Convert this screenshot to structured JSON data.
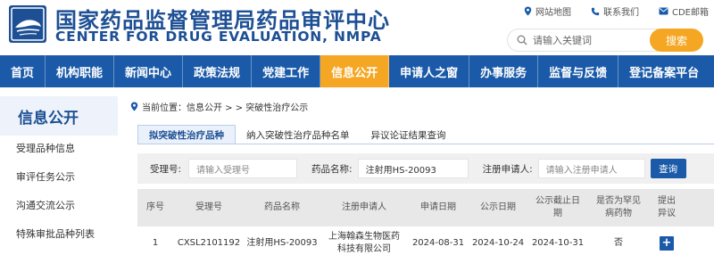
{
  "header": {
    "cn_title": "国家药品监督管理局药品审评中心",
    "en_title": "CENTER FOR DRUG EVALUATION, NMPA",
    "top_links": [
      {
        "label": "网站地图",
        "icon": "location-pin-icon"
      },
      {
        "label": "联系我们",
        "icon": "phone-icon"
      },
      {
        "label": "CDE邮箱",
        "icon": "mail-icon"
      }
    ],
    "search": {
      "placeholder": "请输入关键词",
      "button_label": "搜索"
    },
    "colors": {
      "brand_blue": "#1d4f94",
      "accent_orange": "#f5a623"
    }
  },
  "nav": {
    "items": [
      "首页",
      "机构职能",
      "新闻中心",
      "政策法规",
      "党建工作",
      "信息公开",
      "申请人之窗",
      "办事服务",
      "监督与反馈",
      "登记备案平台"
    ],
    "active_index": 5
  },
  "sidebar": {
    "title": "信息公开",
    "items": [
      "受理品种信息",
      "审评任务公示",
      "沟通交流公示",
      "特殊审批品种列表"
    ]
  },
  "breadcrumb": {
    "text": "当前位置：信息公开 > > 突破性治疗公示"
  },
  "tabs": {
    "items": [
      "拟突破性治疗品种",
      "纳入突破性治疗品种名单",
      "异议论证结果查询"
    ],
    "active_index": 0
  },
  "filter": {
    "accept_no_label": "受理号:",
    "accept_no_placeholder": "请输入受理号",
    "drug_name_label": "药品名称:",
    "drug_name_value": "注射用HS-20093",
    "applicant_label": "注册申请人:",
    "applicant_placeholder": "请输入注册申请人",
    "query_button": "查询"
  },
  "table": {
    "headers": [
      "序号",
      "受理号",
      "药品名称",
      "注册申请人",
      "申请日期",
      "公示日期",
      "公示截止日期",
      "是否为罕见病药物",
      "提出异议"
    ],
    "rows": [
      [
        "1",
        "CXSL2101192",
        "注射用HS-20093",
        "上海翰森生物医药科技有限公司",
        "2024-08-31",
        "2024-10-24",
        "2024-10-31",
        "否",
        "+"
      ]
    ]
  }
}
